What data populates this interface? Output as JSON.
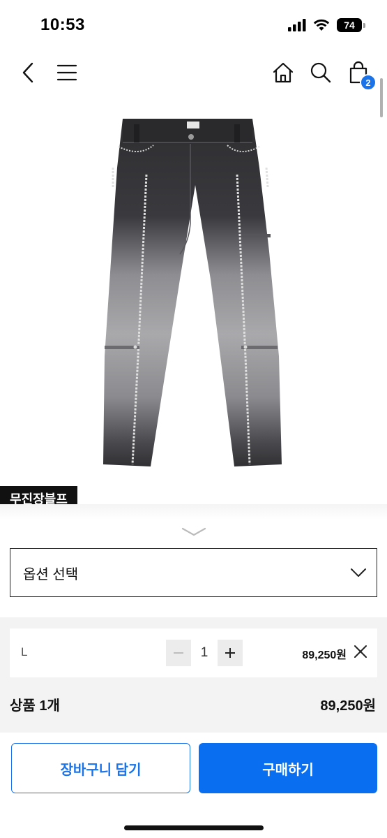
{
  "status_bar": {
    "time": "10:53",
    "battery": "74"
  },
  "nav": {
    "cart_count": "2"
  },
  "product": {
    "brand": "무진장블프"
  },
  "option_select": {
    "label": "옵션 선택"
  },
  "selected_option": {
    "size": "L",
    "quantity": "1",
    "price": "89,250원"
  },
  "summary": {
    "label": "상품 1개",
    "total": "89,250원"
  },
  "actions": {
    "cart_label": "장바구니 담기",
    "buy_label": "구매하기"
  },
  "colors": {
    "accent": "#1a73e8",
    "buy_button": "#0a6ef0",
    "brand_tag": "#111111"
  }
}
